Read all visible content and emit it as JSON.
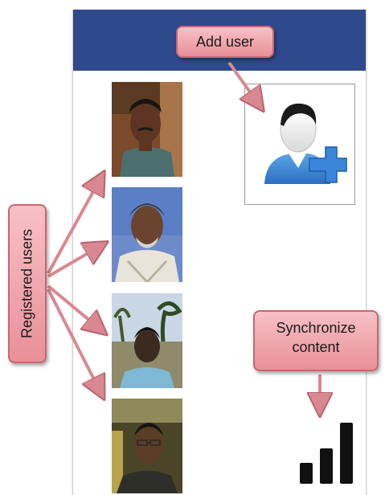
{
  "callouts": {
    "add_user": "Add user",
    "registered_users": "Registered users",
    "synchronize_line1": "Synchronize",
    "synchronize_line2": "content"
  },
  "icons": {
    "add_user": "add-user-icon",
    "sync": "signal-bars-icon"
  },
  "colors": {
    "header": "#2f4a8c",
    "callout_fill": "#f0a9b0",
    "callout_border": "#c96671",
    "arrow": "#d98891",
    "add_user_plus": "#3b86d8",
    "sync_bars": "#111111"
  },
  "users": [
    {
      "name": "registered-user-1"
    },
    {
      "name": "registered-user-2"
    },
    {
      "name": "registered-user-3"
    },
    {
      "name": "registered-user-4"
    }
  ]
}
